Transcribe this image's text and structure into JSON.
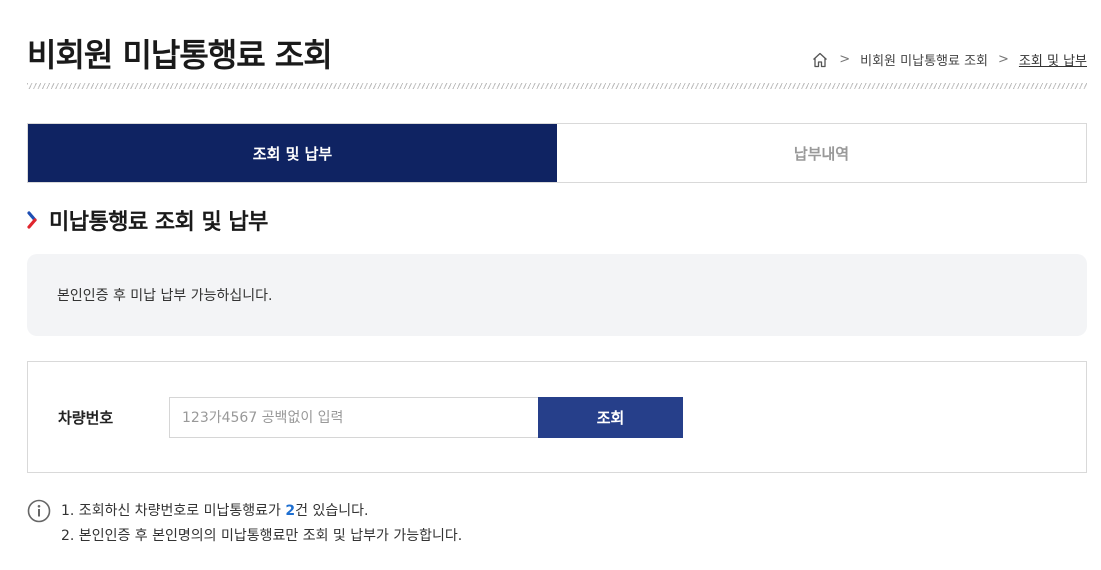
{
  "page": {
    "title": "비회원 미납통행료 조회"
  },
  "breadcrumb": {
    "items": [
      "비회원 미납통행료 조회",
      "조회 및 납부"
    ]
  },
  "tabs": [
    {
      "label": "조회 및 납부",
      "active": true
    },
    {
      "label": "납부내역",
      "active": false
    }
  ],
  "section": {
    "title": "미납통행료 조회 및 납부"
  },
  "notice": {
    "text": "본인인증 후 미납 납부 가능하십니다."
  },
  "search": {
    "label": "차량번호",
    "placeholder": "123가4567 공백없이 입력",
    "value": "",
    "button_label": "조회"
  },
  "info": {
    "line1_prefix": "1. 조회하신 차량번호로 미납통행료가 ",
    "line1_count": "2",
    "line1_suffix": "건 있습니다.",
    "line2": "2. 본인인증 후 본인명의의 미납통행료만 조회 및 납부가 가능합니다."
  },
  "colors": {
    "tab_active_bg": "#0f2362",
    "button_bg": "#263f8a",
    "accent_red": "#e0262e",
    "accent_blue": "#1e4fb3",
    "count_highlight": "#1e6fd1"
  }
}
